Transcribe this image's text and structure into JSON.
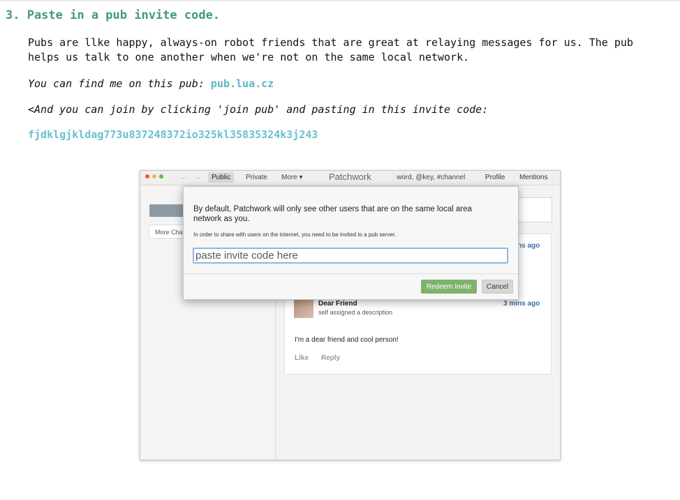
{
  "heading": "3. Paste in a pub invite code.",
  "intro": "Pubs are llke happy, always-on robot friends that are great at relaying messages for us. The pub helps us talk to one another when we're not on the same local network.",
  "find_pub_prefix": "You can find me on this pub: ",
  "pub_link": "pub.lua.cz",
  "join_instructions": "<And you can join by clicking 'join pub' and pasting in this invite code:",
  "invite_code": "fjdklgjkldag773u837248372io325kl35835324k3j243",
  "app": {
    "nav_back": "←",
    "nav_forward": "→",
    "tabs": [
      "Public",
      "Private",
      "More ▾"
    ],
    "app_name": "Patchwork",
    "search_placeholder": "word, @key, #channel",
    "profile": "Profile",
    "mentions": "Mentions",
    "sidebar_more": "More Cha",
    "feed_time_top": "ns ago",
    "post": {
      "author": "Dear Friend",
      "description": "self assigned a description",
      "time": "3 mins ago",
      "body": "I'm a dear friend and cool person!",
      "like": "Like",
      "reply": "Reply"
    },
    "modal": {
      "text": "By default, Patchwork will only see other users that are on the same local area network as you.",
      "subtext": "In order to share with users on the internet, you need to be invited to a pub server.",
      "input_placeholder": "paste invite code here",
      "redeem_label": "Redeem Invite",
      "cancel_label": "Cancel"
    }
  },
  "colors": {
    "heading": "#3f9a7b",
    "link": "#5cb6c6",
    "redeem_button": "#7fb26e",
    "timestamp": "#3f6fa7"
  }
}
